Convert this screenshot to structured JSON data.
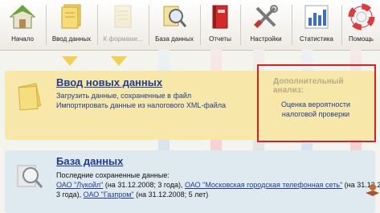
{
  "toolbar": {
    "items": [
      {
        "label": "Начало",
        "icon": "home-icon"
      },
      {
        "label": "Ввод данных",
        "icon": "documents-icon"
      },
      {
        "label": "К формами...",
        "icon": "forms-icon"
      },
      {
        "label": "База данных",
        "icon": "database-search-icon"
      },
      {
        "label": "Отчеты",
        "icon": "reports-book-icon"
      },
      {
        "label": "Настройки",
        "icon": "tools-icon"
      },
      {
        "label": "Статистика",
        "icon": "statistics-chart-icon"
      },
      {
        "label": "Помощь",
        "icon": "lifebuoy-icon"
      }
    ]
  },
  "input_panel": {
    "title": "Ввод новых данных",
    "line1": "Загрузить данные, сохраненные в файл",
    "line2": "Импортировать данные из налогового XML-файла"
  },
  "side_panel": {
    "header_line1": "Дополнительный",
    "header_line2": "анализ:",
    "link_line1": "Оценка вероятности",
    "link_line2": "налоговой проверки"
  },
  "db_panel": {
    "title": "База данных",
    "subtitle": "Последние сохраненные данные:",
    "row1": {
      "link1": "ОАО \"Лукойл\"",
      "text1": " (на 31.12.2008; 3 года), ",
      "link2": "ОАО \"Московская городская телефонная сеть\"",
      "text2": " (на 31.12.2008;"
    },
    "row2": {
      "text0": "3 года), ",
      "link1": "ОАО \"Газпром\"",
      "text1": " (на 31.12.2008; 5 лет)"
    }
  },
  "colors": {
    "accent_red": "#e02020",
    "link_blue": "#1d3d96",
    "input_panel_bg": "#f7e7a9",
    "db_panel_bg": "#dfe9f0"
  }
}
